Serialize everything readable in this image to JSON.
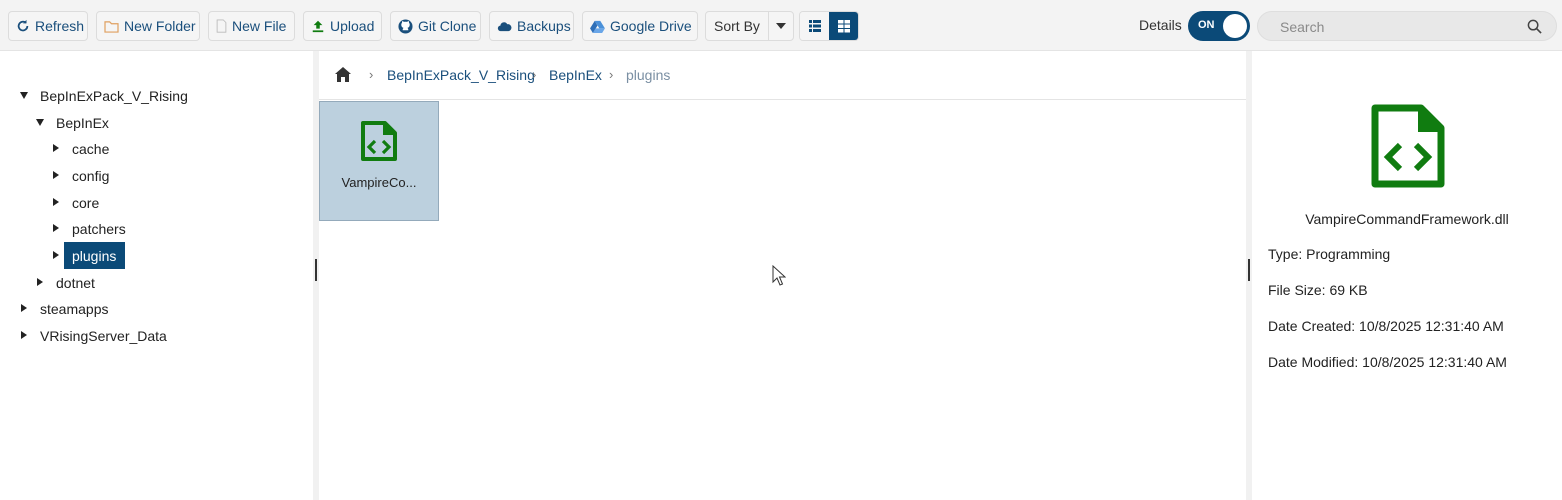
{
  "toolbar": {
    "refresh": "Refresh",
    "new_folder": "New Folder",
    "new_file": "New File",
    "upload": "Upload",
    "git_clone": "Git Clone",
    "backups": "Backups",
    "google_drive": "Google Drive",
    "sort_by": "Sort By",
    "details_label": "Details",
    "toggle_state": "ON",
    "search_placeholder": "Search"
  },
  "tree": {
    "items": [
      {
        "label": "BepInExPack_V_Rising",
        "level": 0,
        "expanded": true
      },
      {
        "label": "BepInEx",
        "level": 1,
        "expanded": true
      },
      {
        "label": "cache",
        "level": 2,
        "expanded": false
      },
      {
        "label": "config",
        "level": 2,
        "expanded": false
      },
      {
        "label": "core",
        "level": 2,
        "expanded": false
      },
      {
        "label": "patchers",
        "level": 2,
        "expanded": false
      },
      {
        "label": "plugins",
        "level": 2,
        "expanded": false,
        "selected": true
      },
      {
        "label": "dotnet",
        "level": 1,
        "expanded": false
      },
      {
        "label": "steamapps",
        "level": 0,
        "expanded": false
      },
      {
        "label": "VRisingServer_Data",
        "level": 0,
        "expanded": false
      }
    ]
  },
  "breadcrumb": {
    "items": [
      "BepInExPack_V_Rising",
      "BepInEx"
    ],
    "current": "plugins"
  },
  "files": [
    {
      "name": "VampireCo..."
    }
  ],
  "details": {
    "name": "VampireCommandFramework.dll",
    "type": "Type: Programming",
    "size": "File Size: 69 KB",
    "created": "Date Created: 10/8/2025 12:31:40 AM",
    "modified": "Date Modified: 10/8/2025 12:31:40 AM"
  },
  "colors": {
    "accent": "#0b4a78",
    "link": "#1a4f7c",
    "file_icon": "#107c10",
    "selected_tile": "#bcd0de"
  }
}
